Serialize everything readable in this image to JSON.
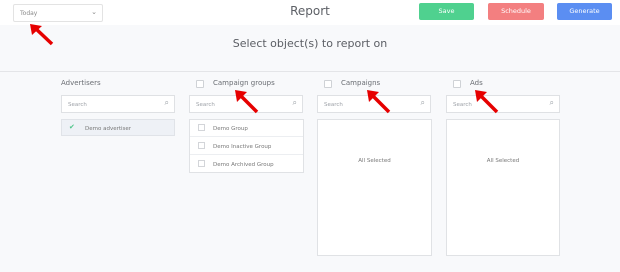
{
  "header": {
    "date_range": "Today",
    "title": "Report",
    "save_label": "Save",
    "schedule_label": "Schedule",
    "generate_label": "Generate"
  },
  "main": {
    "heading": "Select object(s) to report on",
    "search_placeholder": "Search",
    "columns": {
      "advertisers": {
        "title": "Advertisers",
        "items": [
          "Demo advertiser"
        ]
      },
      "campaign_groups": {
        "title": "Campaign groups",
        "items": [
          "Demo Group",
          "Demo Inactive Group",
          "Demo Archived Group"
        ]
      },
      "campaigns": {
        "title": "Campaigns",
        "status": "All Selected"
      },
      "ads": {
        "title": "Ads",
        "status": "All Selected"
      }
    }
  },
  "colors": {
    "save": "#4fd18f",
    "schedule": "#f37f80",
    "generate": "#5b8ef2",
    "annotation_arrow": "#e60000"
  }
}
